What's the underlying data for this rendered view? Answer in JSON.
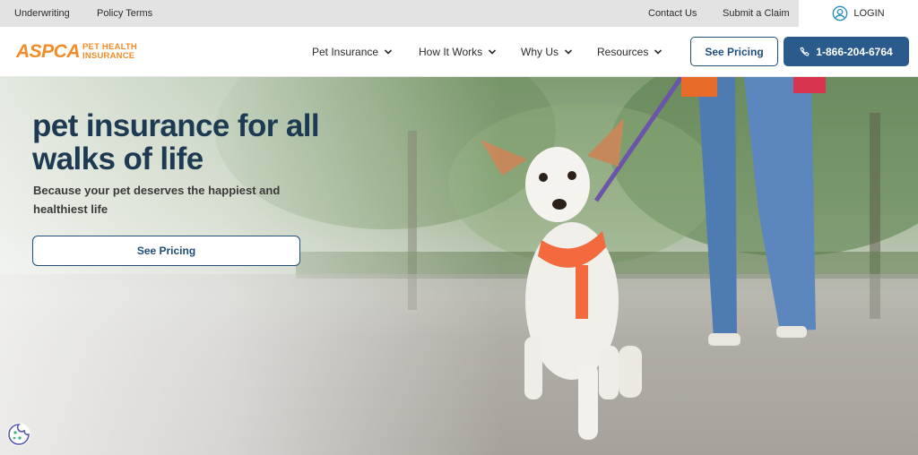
{
  "utility_bar": {
    "left_links": [
      "Underwriting",
      "Policy Terms"
    ],
    "right_links": [
      "Contact Us",
      "Submit a Claim"
    ],
    "login_label": "LOGIN",
    "login_icon": "user-circle-icon"
  },
  "brand": {
    "logo_main": "ASPCA",
    "logo_line1": "PET HEALTH",
    "logo_line2": "INSURANCE",
    "accent_color": "#f28c28"
  },
  "nav": {
    "items": [
      {
        "label": "Pet Insurance"
      },
      {
        "label": "How It Works"
      },
      {
        "label": "Why Us"
      },
      {
        "label": "Resources"
      }
    ],
    "pricing_button": "See Pricing",
    "phone_button": "1-866-204-6764",
    "primary_color": "#2b5b8c"
  },
  "hero": {
    "headline": "pet insurance for all walks of life",
    "subline": "Because your pet deserves the happiest and healthiest life",
    "cta": "See Pricing"
  },
  "cookie_icon": "cookie-icon"
}
